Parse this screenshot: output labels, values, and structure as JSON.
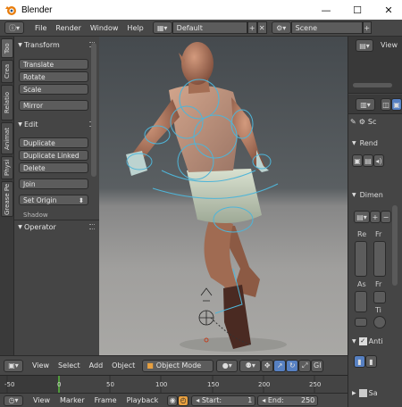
{
  "window": {
    "title": "Blender",
    "minimize": "—",
    "maximize": "☐",
    "close": "✕"
  },
  "menubar": {
    "items": [
      "File",
      "Render",
      "Window",
      "Help"
    ],
    "screen_layout": "Default",
    "scene": "Scene"
  },
  "tool_tabs": [
    "Too",
    "Crea",
    "Relatio",
    "Animat",
    "Physi",
    "Grease Pe"
  ],
  "tool_shelf": {
    "transform_header": "Transform",
    "transform_buttons": [
      "Translate",
      "Rotate",
      "Scale"
    ],
    "mirror": "Mirror",
    "edit_header": "Edit",
    "edit_buttons": [
      "Duplicate",
      "Duplicate Linked",
      "Delete"
    ],
    "join": "Join",
    "set_origin": "Set Origin",
    "shading": "Shadow",
    "operator_header": "Operator"
  },
  "viewport_header": {
    "items": [
      "View",
      "Select",
      "Add",
      "Object"
    ],
    "mode": "Object Mode",
    "global": "Gl"
  },
  "timeline": {
    "ticks": [
      "-50",
      "0",
      "50",
      "100",
      "150",
      "200",
      "250"
    ],
    "current_frame": 0
  },
  "timeline_header": {
    "items": [
      "View",
      "Marker",
      "Frame",
      "Playback"
    ],
    "start_label": "Start:",
    "start_value": "1",
    "end_label": "End:",
    "end_value": "250"
  },
  "properties": {
    "view_label": "View",
    "scene_label": "Sc",
    "render_label": "Rend",
    "dimensions_label": "Dimen",
    "res_label": "Re",
    "fr_label": "Fr",
    "as_label": "As",
    "ti_label": "Ti",
    "anti_label": "Anti",
    "sa_label": "Sa"
  }
}
